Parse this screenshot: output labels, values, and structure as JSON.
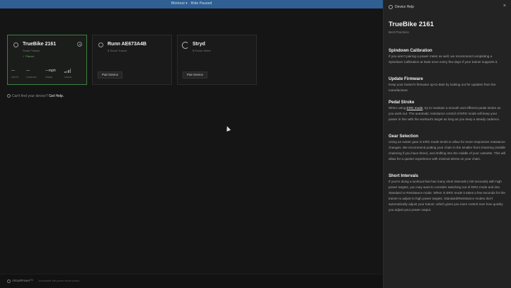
{
  "topbar": {
    "title": "Workout ▾ · Ride Paused"
  },
  "cards": [
    {
      "name": "TrueBike 2161",
      "subtitle": "Smart Trainer",
      "status": "Paired",
      "metrics": [
        {
          "value": "—",
          "label": "WATTS"
        },
        {
          "value": "—",
          "label": "CADENCE"
        },
        {
          "value": "—mph",
          "label": "SPEED"
        },
        {
          "value": "",
          "label": "SIGNAL"
        }
      ]
    },
    {
      "name": "Runn AE673A4B",
      "subtitle": "Smart Trainer",
      "button": "Pair Device"
    },
    {
      "name": "Stryd",
      "subtitle": "Power Meter",
      "button": "Pair Device"
    }
  ],
  "help_line": {
    "text": "Can't find your device?",
    "link": "Get Help."
  },
  "bottombar": {
    "brand": "VirtualPower™",
    "note": "Unavailable with power device paired"
  },
  "panel": {
    "header": "Device Help",
    "close": "×",
    "title": "TrueBike 2161",
    "subtitle": "Best Practices",
    "sections": [
      {
        "title": "Spindown Calibration",
        "body": "If you aren't pairing a power meter as well, we recommend completing a Spindown Calibration at least once every few days if your trainer supports it."
      },
      {
        "title": "Update Firmware",
        "body": "Keep your trainer's firmware up-to-date by looking out for updates from the manufacturer."
      },
      {
        "title": "Pedal Stroke",
        "body_before": "When using ",
        "body_link": "ERG mode",
        "body_after": ", try to maintain a smooth and efficient pedal stroke as you work out. The automatic resistance control of ERG mode will keep your power in line with the workout's target as long as you keep a steady cadence."
      },
      {
        "title": "Gear Selection",
        "body": "Using an easier gear in ERG mode tends to allow for more responsive resistance changes. We recommend putting your chain in the smaller front chainring (middle chainring if you have three), and shifting into the middle of your cassette. This will allow for a quieter experience with minimal stress on your chain."
      },
      {
        "title": "Short Intervals",
        "body": "If you're doing a workout that has many short intervals (<30 seconds) with high power targets, you may want to consider switching out of ERG mode and into Standard or Resistance mode. When in ERG mode it takes a few seconds for the trainer to adjust to high power targets.  Standard/Resistance modes don't automatically adjust your trainer, which gives you more control over how quickly you adjust your power output."
      }
    ]
  }
}
